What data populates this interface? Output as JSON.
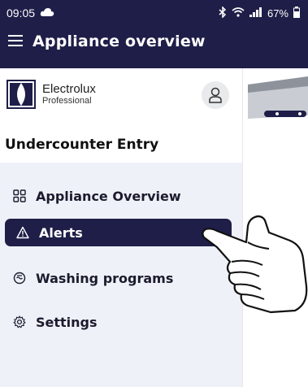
{
  "status": {
    "time": "09:05",
    "battery": "67%"
  },
  "header": {
    "title": "Appliance overview"
  },
  "drawer": {
    "brand_name": "Electrolux",
    "brand_sub": "Professional",
    "device_name": "Undercounter Entry",
    "items": [
      {
        "label": "Appliance Overview",
        "icon": "grid-icon",
        "active": false
      },
      {
        "label": "Alerts",
        "icon": "warning-icon",
        "active": true
      },
      {
        "label": "Washing programs",
        "icon": "wash-icon",
        "active": false
      },
      {
        "label": "Settings",
        "icon": "gear-icon",
        "active": false
      }
    ]
  },
  "colors": {
    "primary": "#1e1e48",
    "menu_bg": "#eef1f7",
    "text": "#1b1b2e"
  }
}
